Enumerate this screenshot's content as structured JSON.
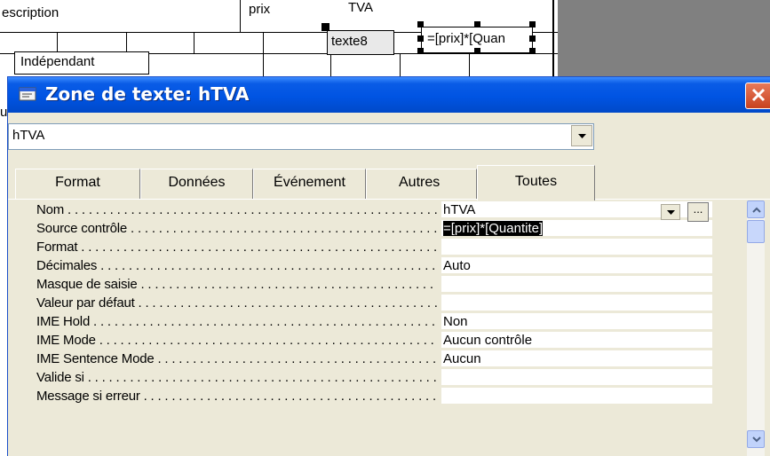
{
  "designer": {
    "description_label": "escription",
    "prix_label": "prix",
    "tva_label": "TVA",
    "texte8_label": "texte8",
    "expr_label": "=[prix]*[Quan",
    "indep_label": "Indépendant",
    "stray_char": "u"
  },
  "window": {
    "title": "Zone de texte: hTVA",
    "title_icon": "properties-icon",
    "close_icon": "close-icon"
  },
  "object_select": {
    "value": "hTVA"
  },
  "tabs": [
    {
      "label": "Format"
    },
    {
      "label": "Données"
    },
    {
      "label": "Événement"
    },
    {
      "label": "Autres"
    },
    {
      "label": "Toutes",
      "active": true
    }
  ],
  "properties": [
    {
      "label": "Nom",
      "value": "hTVA"
    },
    {
      "label": "Source contrôle",
      "value": "=[prix]*[Quantite]"
    },
    {
      "label": "Format",
      "value": ""
    },
    {
      "label": "Décimales",
      "value": "Auto"
    },
    {
      "label": "Masque de saisie",
      "value": ""
    },
    {
      "label": "Valeur par défaut",
      "value": ""
    },
    {
      "label": "IME Hold",
      "value": "Non"
    },
    {
      "label": "IME Mode",
      "value": "Aucun contrôle"
    },
    {
      "label": "IME Sentence Mode",
      "value": "Aucun"
    },
    {
      "label": "Valide si",
      "value": ""
    },
    {
      "label": "Message si erreur",
      "value": ""
    }
  ],
  "builder_button_label": "...",
  "colors": {
    "title_bar": "#0054e3",
    "window_bg": "#ece9d8",
    "close_button": "#c8421f"
  }
}
